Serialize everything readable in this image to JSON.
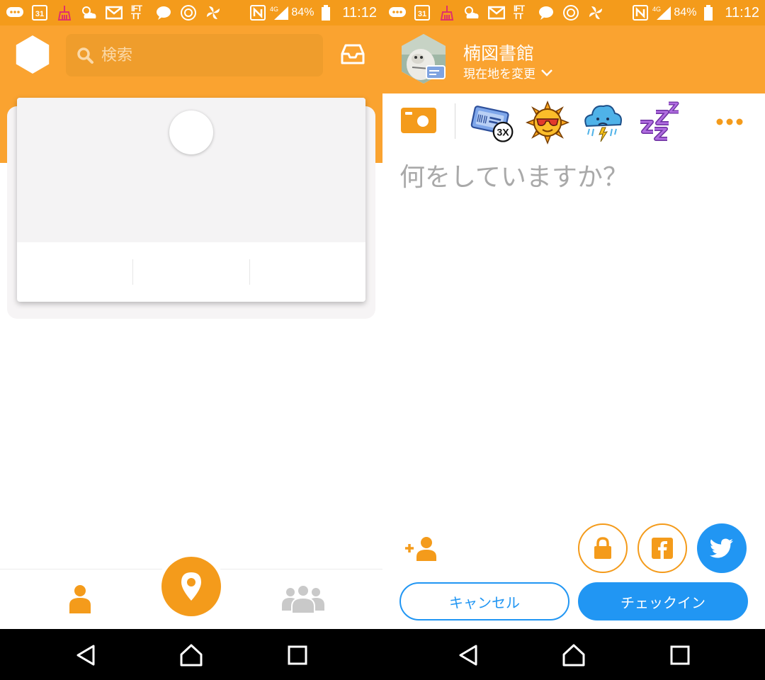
{
  "status_bar": {
    "calendar_day": "31",
    "battery_percent": "84%",
    "time": "11:12",
    "network": "4G",
    "iftt_label": "IFT\nTT",
    "icons": [
      "messages-icon",
      "calendar-icon",
      "broom-icon",
      "weather-icon",
      "gmail-icon",
      "ifttt-icon",
      "chat-bubble-icon",
      "swarm-icon",
      "pinwheel-icon",
      "nfc-icon",
      "signal-icon",
      "battery-icon"
    ]
  },
  "left": {
    "search": {
      "placeholder": "検索"
    },
    "bottom_nav": [
      "profile-tab",
      "checkin-tab",
      "friends-tab"
    ]
  },
  "right": {
    "venue": {
      "name": "楠図書館",
      "change_location": "現在地を変更"
    },
    "stickers": [
      {
        "name": "ticket-sticker",
        "badge": "3X"
      },
      {
        "name": "sunglasses-sun-sticker"
      },
      {
        "name": "storm-cloud-sticker"
      },
      {
        "name": "sleep-zzz-sticker"
      }
    ],
    "shout_placeholder": "何をしていますか？",
    "buttons": {
      "cancel": "キャンセル",
      "checkin": "チェックイン"
    }
  },
  "colors": {
    "orange": "#faa330",
    "orange_dark": "#f49b1b",
    "blue": "#2196f3"
  }
}
